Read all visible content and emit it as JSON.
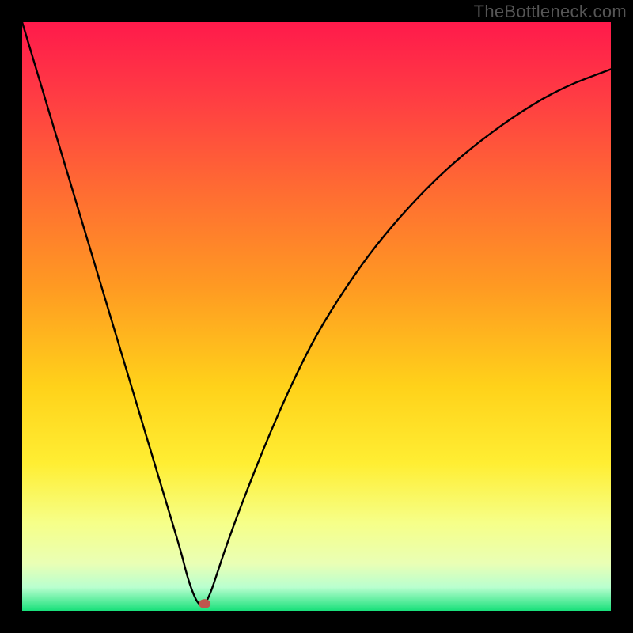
{
  "watermark": "TheBottleneck.com",
  "chart_data": {
    "type": "line",
    "title": "",
    "xlabel": "",
    "ylabel": "",
    "xlim": [
      0,
      100
    ],
    "ylim": [
      0,
      100
    ],
    "optimum_x": 30,
    "marker": {
      "x": 31,
      "y": 1.2,
      "color": "#c0554d"
    },
    "series": [
      {
        "name": "bottleneck-curve",
        "x": [
          0,
          3,
          6,
          9,
          12,
          15,
          18,
          21,
          24,
          27,
          28,
          29,
          30,
          31,
          32,
          33,
          35,
          38,
          42,
          46,
          50,
          55,
          60,
          66,
          72,
          78,
          85,
          92,
          100
        ],
        "y": [
          100,
          90,
          80,
          70,
          60,
          50,
          40,
          30,
          20,
          10,
          6,
          3,
          1,
          1,
          3,
          6,
          12,
          20,
          30,
          39,
          47,
          55,
          62,
          69,
          75,
          80,
          85,
          89,
          92
        ]
      }
    ],
    "background_gradient": {
      "stops": [
        {
          "pos": 0.0,
          "color": "#ff1a4b"
        },
        {
          "pos": 0.12,
          "color": "#ff3a44"
        },
        {
          "pos": 0.28,
          "color": "#ff6a33"
        },
        {
          "pos": 0.45,
          "color": "#ff9a22"
        },
        {
          "pos": 0.62,
          "color": "#ffd21a"
        },
        {
          "pos": 0.75,
          "color": "#ffee33"
        },
        {
          "pos": 0.85,
          "color": "#f6ff88"
        },
        {
          "pos": 0.92,
          "color": "#e9ffb5"
        },
        {
          "pos": 0.96,
          "color": "#b9ffcf"
        },
        {
          "pos": 1.0,
          "color": "#18e07a"
        }
      ]
    }
  }
}
